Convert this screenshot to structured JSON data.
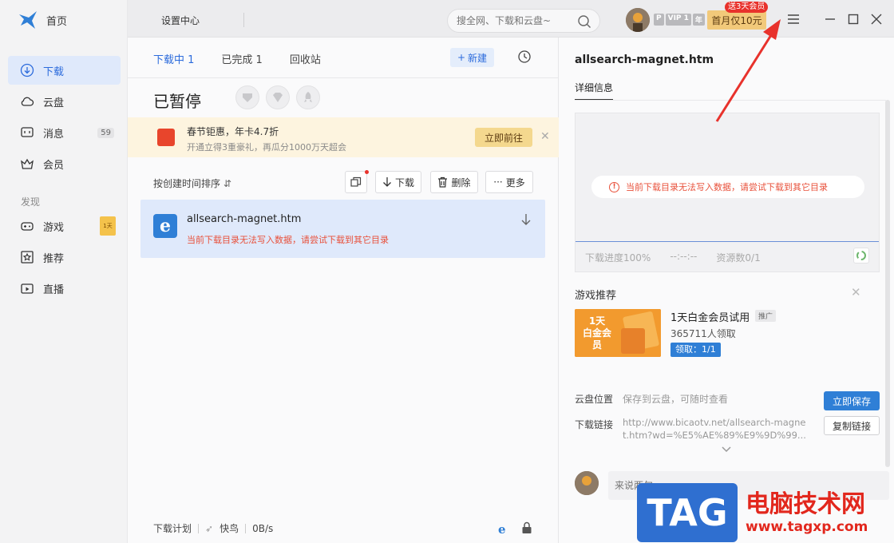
{
  "sidebar": {
    "home": "首页",
    "items": [
      {
        "label": "下载",
        "icon": "download-icon"
      },
      {
        "label": "云盘",
        "icon": "cloud-icon"
      },
      {
        "label": "消息",
        "icon": "message-icon",
        "badge": "59"
      },
      {
        "label": "会员",
        "icon": "crown-icon"
      }
    ],
    "discover_label": "发现",
    "discover_items": [
      {
        "label": "游戏",
        "icon": "gamepad-icon",
        "thumb": "1天"
      },
      {
        "label": "推荐",
        "icon": "star-icon"
      },
      {
        "label": "直播",
        "icon": "live-icon"
      }
    ]
  },
  "topbar": {
    "settings": "设置中心",
    "search_placeholder": "搜全网、下载和云盘~",
    "vip_tags": [
      "P",
      "VIP 1",
      "年"
    ],
    "promo": "首月仅10元",
    "promo_badge": "送3天会员"
  },
  "center": {
    "tabs": [
      "下载中 1",
      "已完成 1",
      "回收站"
    ],
    "new_button": "新建",
    "status_title": "已暂停",
    "banner": {
      "title": "春节钜惠，年卡4.7折",
      "subtitle": "开通立得3重豪礼，再瓜分1000万天超会",
      "go": "立即前往"
    },
    "sort": "按创建时间排序",
    "toolbar": {
      "download": "下载",
      "delete": "删除",
      "more": "更多"
    },
    "file": {
      "name": "allsearch-magnet.htm",
      "error": "当前下载目录无法写入数据，请尝试下载到其它目录"
    },
    "footer": {
      "plan": "下载计划",
      "mode": "快鸟",
      "speed": "0B/s"
    }
  },
  "detail": {
    "title": "allsearch-magnet.htm",
    "tab": "详细信息",
    "error": "当前下载目录无法写入数据，请尝试下载到其它目录",
    "progress_label": "下载进度100%",
    "time": "--:--:--",
    "resources": "资源数0/1",
    "game_section": "游戏推荐",
    "game": {
      "thumb_main": "1天\n白金会员",
      "name": "1天白金会员试用",
      "ad": "推广",
      "count": "365711人领取",
      "claim": "领取：1/1"
    },
    "cloud_label": "云盘位置",
    "cloud_value": "保存到云盘，可随时查看",
    "save": "立即保存",
    "link_label": "下载链接",
    "link_value": "http://www.bicaotv.net/allsearch-magnet.htm?wd=%E5%AE%89%E9%9D%99...",
    "copy": "复制链接",
    "comment_placeholder": "来说两句"
  },
  "watermark": {
    "tag": "TAG",
    "cn": "电脑技术网",
    "url": "www.tagxp.com"
  },
  "colors": {
    "accent": "#2c6bdc",
    "error": "#e8503a",
    "arrow": "#e8322c"
  }
}
